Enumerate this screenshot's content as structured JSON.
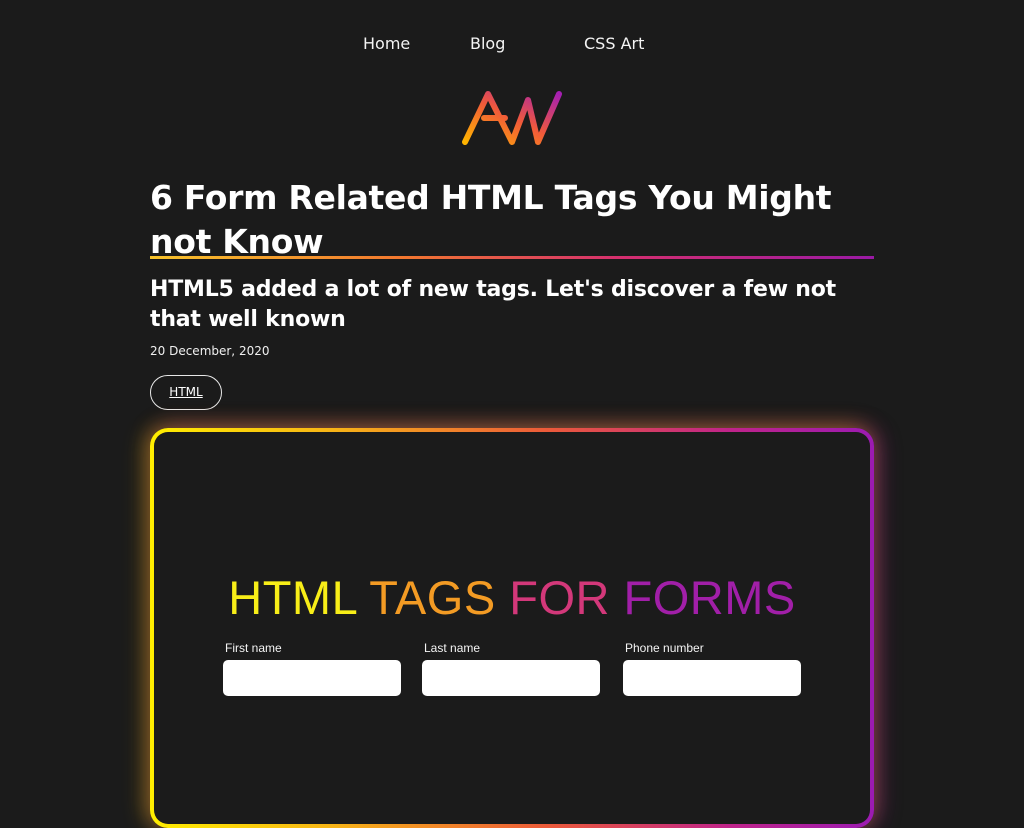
{
  "nav": {
    "items": [
      {
        "label": "Home"
      },
      {
        "label": "Blog"
      },
      {
        "label": "CSS Art"
      }
    ]
  },
  "logo": {
    "text": "AW",
    "colors": [
      "#ffb400",
      "#f15a3a",
      "#a51fb3"
    ]
  },
  "article": {
    "title": "6 Form Related HTML Tags You Might not Know",
    "subtitle": "HTML5 added a lot of new tags. Let's discover a few not that well known",
    "date": "20 December, 2020",
    "tags": [
      "HTML"
    ]
  },
  "hero": {
    "heading_words": [
      "HTML",
      "TAGS",
      "FOR",
      "FORMS"
    ],
    "fields": [
      {
        "label": "First name",
        "value": "",
        "placeholder": ""
      },
      {
        "label": "Last name",
        "value": "",
        "placeholder": ""
      },
      {
        "label": "Phone number",
        "value": "",
        "placeholder": ""
      }
    ]
  },
  "colors": {
    "background": "#1b1b1b",
    "gradient_start": "#ffee00",
    "gradient_mid": "#ec5a3a",
    "gradient_end": "#9b1bb2"
  }
}
